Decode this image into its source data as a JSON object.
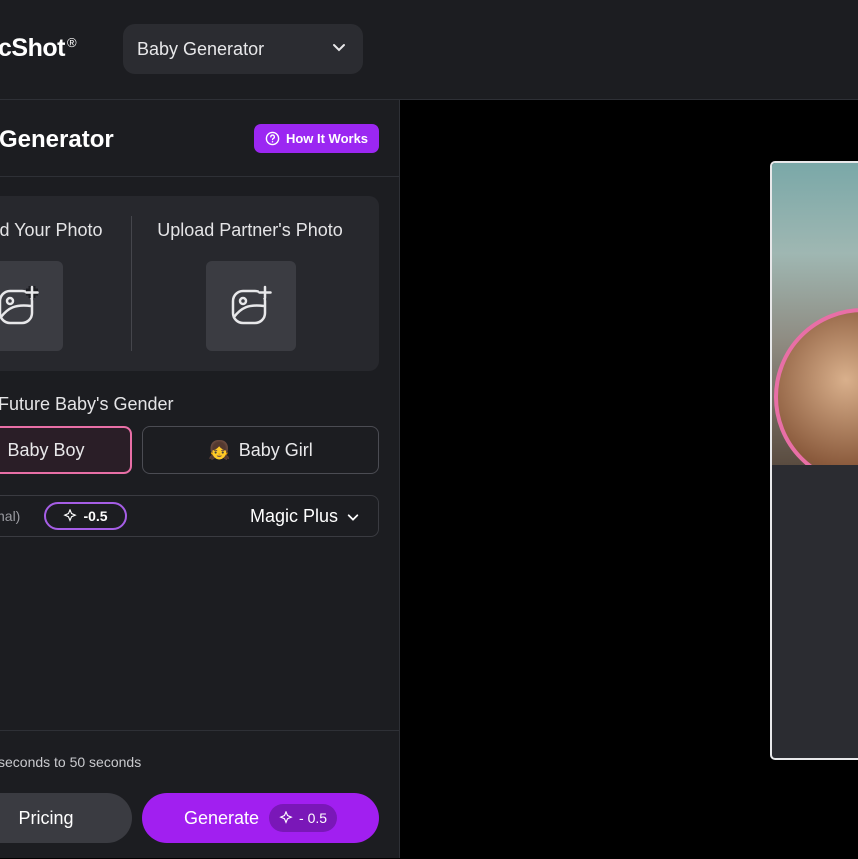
{
  "app": {
    "logo_text": "cShot",
    "logo_mark": "®"
  },
  "tool_selector": {
    "value": "Baby Generator"
  },
  "panel": {
    "title": "Generator",
    "how_it_works": "How It Works",
    "upload_yours": "d Your Photo",
    "upload_partner": "Upload Partner's Photo",
    "gender_label": "Future Baby's Gender",
    "gender_options": [
      "Baby Boy",
      "Baby Girl"
    ],
    "girl_emoji": "👧",
    "mode_hint": "nal)",
    "credit_cost": "-0.5",
    "model": "Magic Plus",
    "eta": "seconds to 50 seconds",
    "pricing": "Pricing",
    "generate": "Generate",
    "generate_cost": "- 0.5"
  },
  "colors": {
    "accent": "#9b27f2",
    "selected_border": "#e86fa6",
    "panel_bg": "#1c1d21"
  }
}
